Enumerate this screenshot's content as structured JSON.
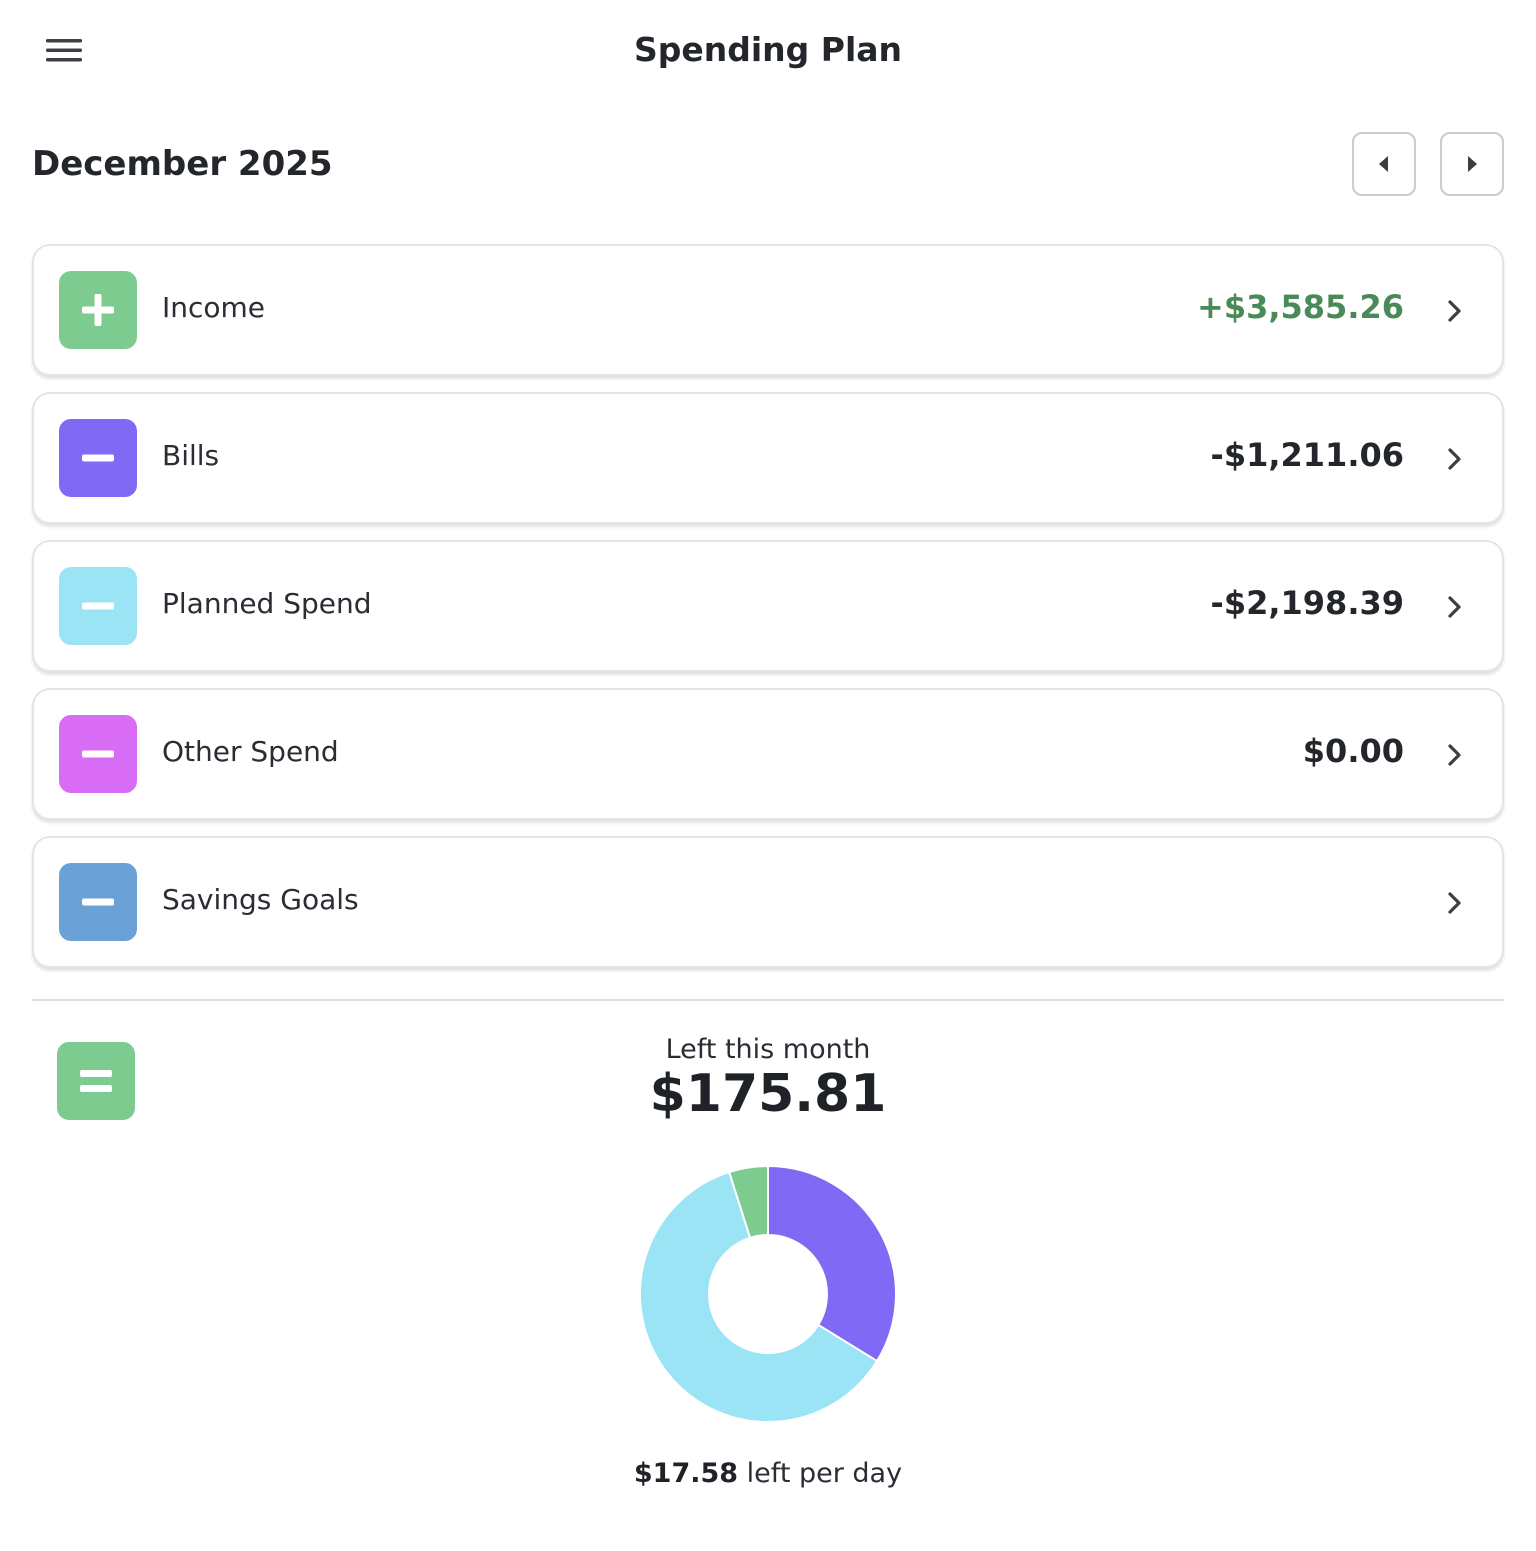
{
  "header": {
    "title": "Spending Plan",
    "menu_icon": "hamburger-menu-icon"
  },
  "period": {
    "month_label": "December 2025",
    "prev_icon": "caret-left-icon",
    "next_icon": "caret-right-icon"
  },
  "categories": [
    {
      "label": "Income",
      "amount": "+$3,585.26",
      "icon": "plus-icon",
      "color": "#7ecb8f",
      "amount_color": "#4a8a58"
    },
    {
      "label": "Bills",
      "amount": "-$1,211.06",
      "icon": "minus-icon",
      "color": "#8069f5"
    },
    {
      "label": "Planned Spend",
      "amount": "-$2,198.39",
      "icon": "minus-icon",
      "color": "#9ae4f6"
    },
    {
      "label": "Other Spend",
      "amount": "$0.00",
      "icon": "minus-icon",
      "color": "#d86cf4"
    },
    {
      "label": "Savings Goals",
      "amount": "",
      "icon": "minus-icon",
      "color": "#6aa2d8"
    }
  ],
  "summary": {
    "icon": "equals-icon",
    "icon_color": "#7ecb8f",
    "left_label": "Left this month",
    "left_amount": "$175.81",
    "per_day_amount": "$17.58",
    "per_day_suffix": " left per day"
  },
  "chart_data": {
    "type": "pie",
    "donut": true,
    "slices": [
      {
        "category": "Bills",
        "value": 1211.06,
        "color": "#8069f5"
      },
      {
        "category": "Planned Spend",
        "value": 2198.39,
        "color": "#9ae4f6"
      },
      {
        "category": "Left this month",
        "value": 175.81,
        "color": "#7ecb8f"
      }
    ]
  }
}
